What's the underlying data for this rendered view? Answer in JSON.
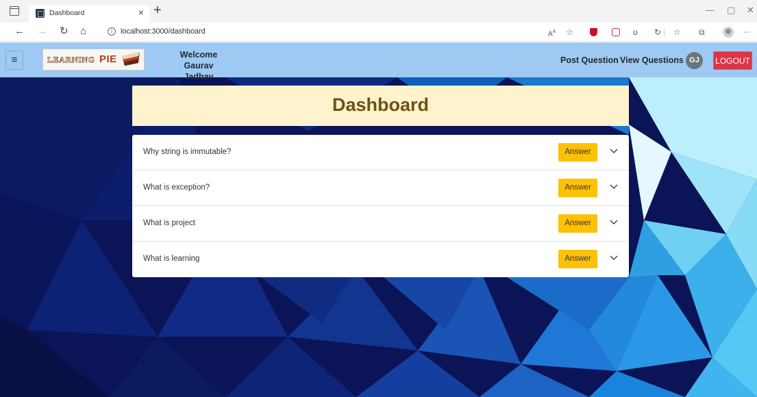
{
  "browser": {
    "tab_title": "Dashboard",
    "tab_close": "×",
    "new_tab": "+",
    "url": "localhost:3000/dashboard",
    "url_info_icon": "i",
    "win_minimize": "—",
    "win_restore": "▢",
    "win_close": "✕",
    "nav": {
      "back": "←",
      "forward": "→",
      "reload": "↻",
      "home": "⌂"
    },
    "toolbar_more": "···"
  },
  "header": {
    "menu_icon": "≡",
    "logo_learning": "LEARNING",
    "logo_pie": "PIE",
    "welcome_line1": "Welcome",
    "welcome_line2": "Gaurav Jadhav",
    "post_question": "Post Question",
    "view_questions": "View Questions",
    "avatar_initials": "GJ",
    "logout": "LOGOUT"
  },
  "dashboard": {
    "title": "Dashboard",
    "questions": [
      {
        "text": "Why string is immutable?",
        "action": "Answer"
      },
      {
        "text": "What is exception?",
        "action": "Answer"
      },
      {
        "text": "What is project",
        "action": "Answer"
      },
      {
        "text": "What is learning",
        "action": "Answer"
      }
    ]
  },
  "colors": {
    "header_bg": "#9ec9f2",
    "title_card_bg": "#fff3cd",
    "title_text": "#6e5214",
    "answer_btn": "#ffc107",
    "logout_btn": "#dc3545",
    "avatar_bg": "#6c757d"
  }
}
